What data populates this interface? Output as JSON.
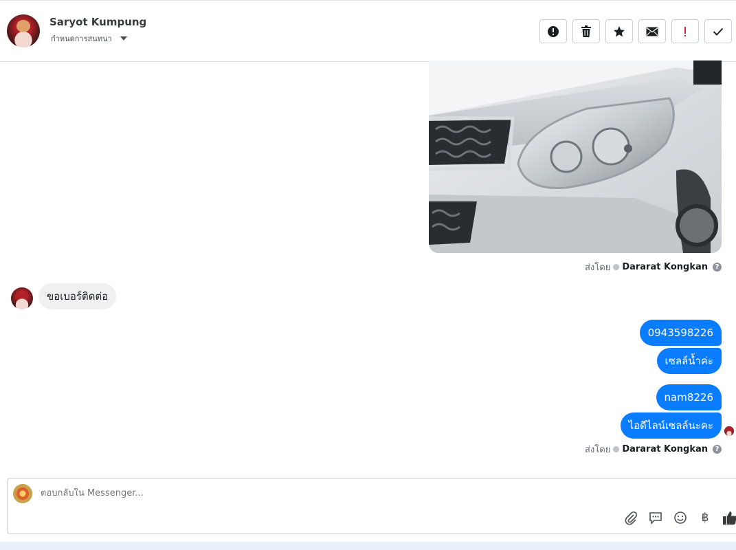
{
  "header": {
    "contact_name": "Saryot Kumpung",
    "conversation_setting": "กำหนดการสนทนา",
    "toolbar": [
      {
        "name": "spam-button",
        "icon": "alert-circle-icon"
      },
      {
        "name": "delete-button",
        "icon": "trash-icon"
      },
      {
        "name": "star-button",
        "icon": "star-icon"
      },
      {
        "name": "mark-unread-button",
        "icon": "envelope-icon"
      },
      {
        "name": "follow-up-button",
        "icon": "exclamation-icon"
      },
      {
        "name": "mark-done-button",
        "icon": "checkmark-icon"
      }
    ]
  },
  "thread": {
    "sent_by_1": {
      "prefix": "ส่งโดย",
      "name": "Dararat Kongkan"
    },
    "incoming_message": "ขอเบอร์ติดต่อ",
    "outgoing_messages": [
      "0943598226",
      "เซลล์น้ำค่ะ",
      "nam8226",
      "ไอดีไลน์เซลล์นะคะ"
    ],
    "sent_by_2": {
      "prefix": "ส่งโดย",
      "name": "Dararat Kongkan"
    }
  },
  "composer": {
    "placeholder": "ตอบกลับใน Messenger...",
    "tools": [
      "paperclip-icon",
      "saved-reply-icon",
      "emoji-icon",
      "baht-icon",
      "thumbs-up-icon"
    ],
    "baht_symbol": "฿"
  },
  "colors": {
    "accent": "#0a7cff",
    "follow_up": "#e41e3f"
  }
}
